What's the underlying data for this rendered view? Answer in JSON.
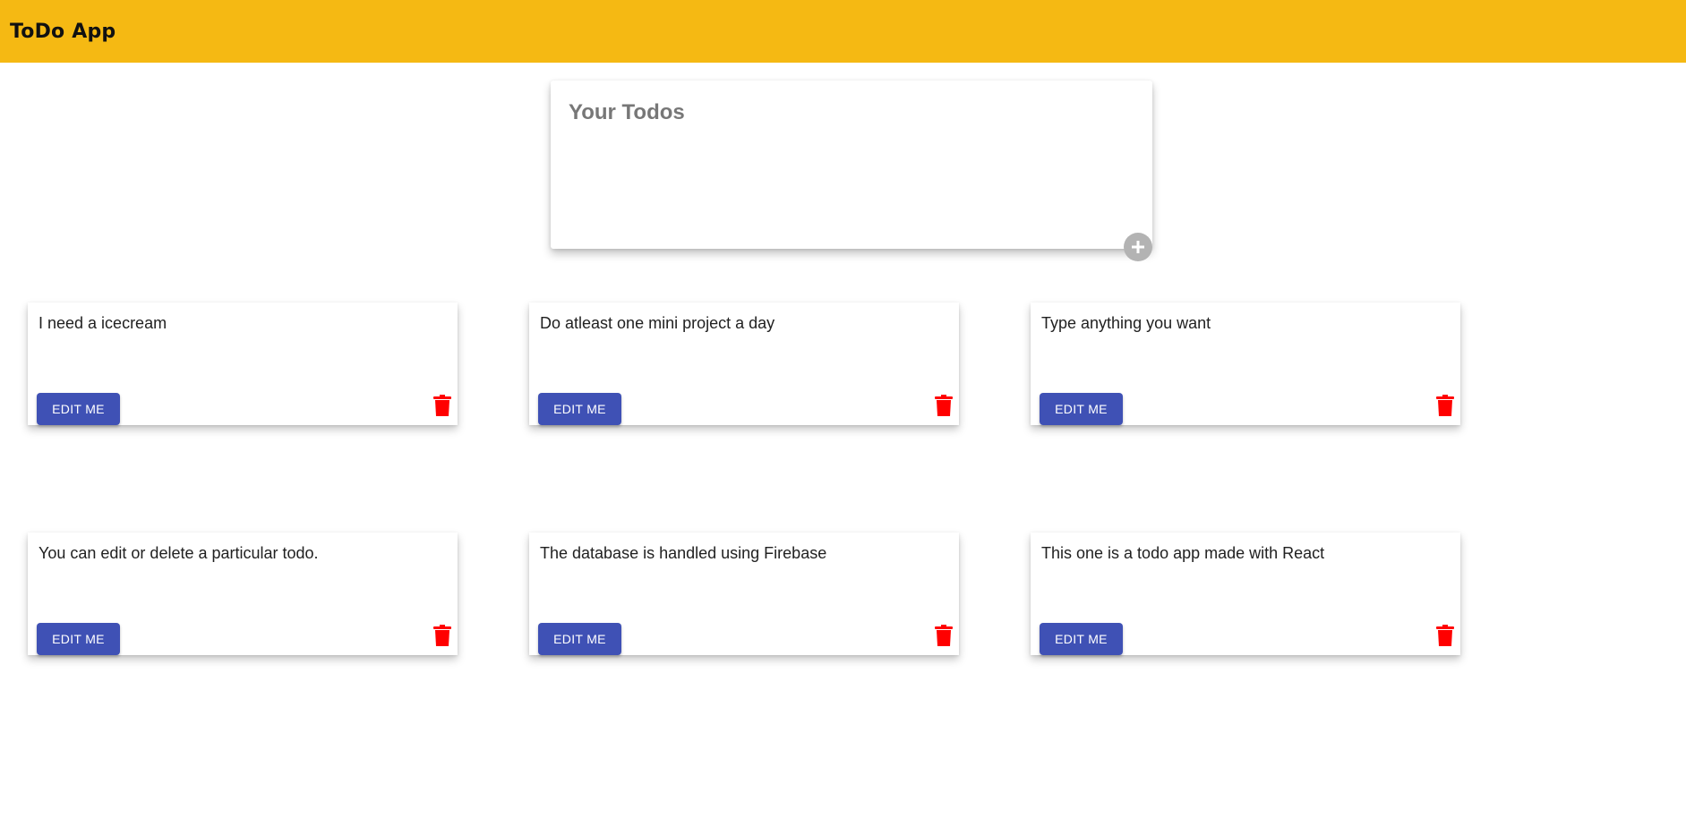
{
  "appbar": {
    "title": "ToDo App",
    "color": "#f5b913"
  },
  "composer": {
    "placeholder": "Your Todos",
    "add_icon": "plus-icon"
  },
  "notes": [
    {
      "text": "I need a icecream",
      "edit_label": "EDIT ME",
      "delete_icon": "trash-icon"
    },
    {
      "text": "Do atleast one mini project a day",
      "edit_label": "EDIT ME",
      "delete_icon": "trash-icon"
    },
    {
      "text": "Type anything you want",
      "edit_label": "EDIT ME",
      "delete_icon": "trash-icon"
    },
    {
      "text": "You can edit or delete a particular todo.",
      "edit_label": "EDIT ME",
      "delete_icon": "trash-icon"
    },
    {
      "text": "The database is handled using Firebase",
      "edit_label": "EDIT ME",
      "delete_icon": "trash-icon"
    },
    {
      "text": "This one is a todo app made with React",
      "edit_label": "EDIT ME",
      "delete_icon": "trash-icon"
    }
  ],
  "colors": {
    "edit_button": "#3f51b5",
    "delete_icon": "#ff0000",
    "add_button": "#b3b3b3"
  }
}
